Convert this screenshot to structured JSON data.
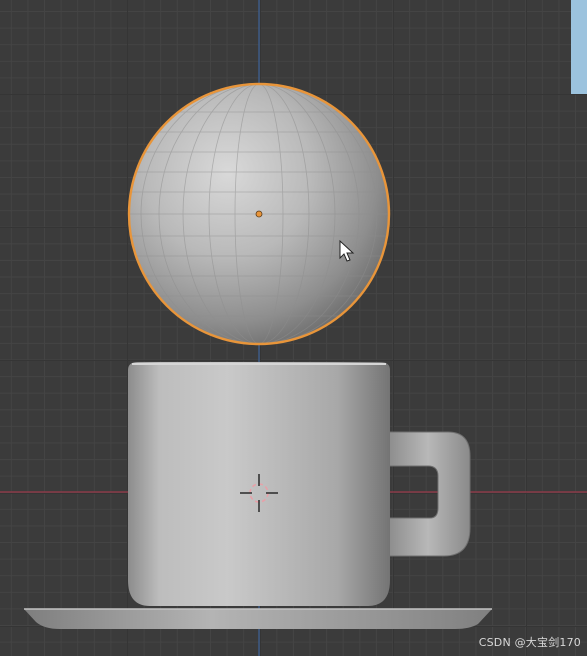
{
  "viewport": {
    "scene_objects": [
      "sphere",
      "cup",
      "saucer"
    ],
    "selected_object": "sphere",
    "selection_outline_color": "#e8953a",
    "x_axis_color": "#8a3a48",
    "y_axis_color": "#3a5a8a",
    "grid_color": "#3b3b3b"
  },
  "watermark": {
    "text": "CSDN @大宝剑170"
  }
}
